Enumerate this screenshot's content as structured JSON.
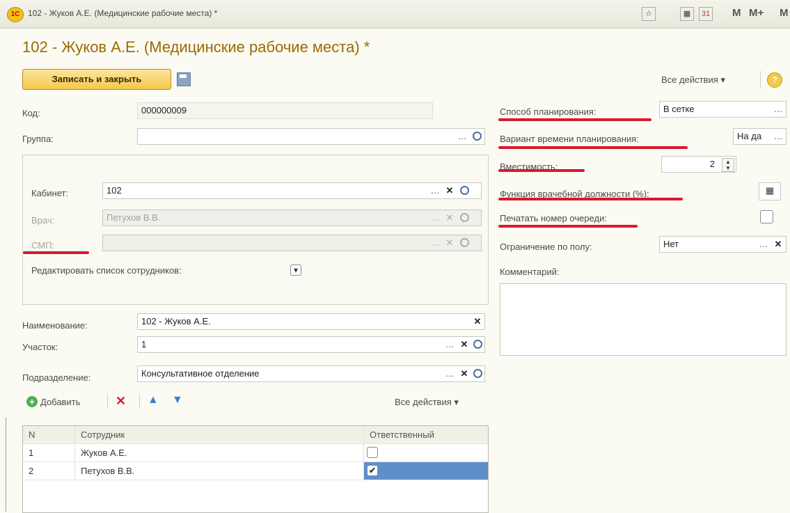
{
  "window": {
    "title": "102 - Жуков А.Е. (Медицинские рабочие места) *",
    "logo": "1С",
    "tools": [
      "M",
      "M+",
      "M"
    ]
  },
  "form": {
    "title": "102 - Жуков А.Е. (Медицинские рабочие места) *",
    "save_close": "Записать и закрыть",
    "all_actions": "Все действия ▾",
    "help": "?"
  },
  "left": {
    "code_label": "Код:",
    "code_value": "000000009",
    "group_label": "Группа:",
    "group_value": "",
    "room_label": "Кабинет:",
    "room_value": "102",
    "doctor_label": "Врач:",
    "doctor_value": "Петухов В.В.",
    "smp_label": "СМП:",
    "smp_value": "",
    "edit_staff_label": "Редактировать список сотрудников:",
    "name_label": "Наименование:",
    "name_value": "102 - Жуков А.Е.",
    "area_label": "Участок:",
    "area_value": "1",
    "dept_label": "Подразделение:",
    "dept_value": "Консультативное отделение"
  },
  "right": {
    "plan_method_label": "Способ планирования:",
    "plan_method_value": "В сетке",
    "plan_time_label": "Вариант времени планирования:",
    "plan_time_value": "На да",
    "capacity_label": "Вместимость:",
    "capacity_value": "2",
    "function_label": "Функция врачебной должности (%):",
    "print_queue_label": "Печатать номер очереди:",
    "gender_label": "Ограничение по полу:",
    "gender_value": "Нет",
    "comment_label": "Комментарий:"
  },
  "table_toolbar": {
    "add": "Добавить",
    "all_actions": "Все действия ▾"
  },
  "table": {
    "headers": [
      "N",
      "Сотрудник",
      "Ответственный"
    ],
    "rows": [
      {
        "n": "1",
        "name": "Жуков А.Е.",
        "responsible": false
      },
      {
        "n": "2",
        "name": "Петухов В.В.",
        "responsible": true
      }
    ]
  },
  "colors": {
    "accent": "#9a6b00",
    "underline": "#d8192e",
    "selected": "#5f8fc9"
  }
}
